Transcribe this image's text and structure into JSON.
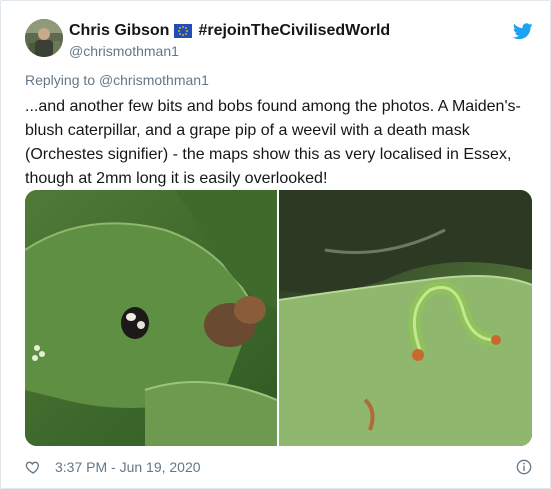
{
  "user": {
    "display_name": "Chris Gibson",
    "hashtag": "#rejoinTheCivilisedWorld",
    "handle": "@chrismothman1"
  },
  "reply": {
    "prefix": "Replying to",
    "mention": "@chrismothman1"
  },
  "tweet": {
    "text": "...and another few bits and bobs found among the photos. A Maiden's-blush caterpillar, and a grape pip of a weevil with a death mask (Orchestes signifier) - the maps show this as very localised in Essex, though at 2mm long it is easily overlooked!"
  },
  "footer": {
    "timestamp": "3:37 PM - Jun 19, 2020"
  },
  "icons": {
    "avatar": "avatar-photo",
    "flag": "eu-flag-icon",
    "brand": "twitter-bird-icon",
    "like": "heart-icon",
    "info": "info-icon"
  },
  "colors": {
    "brand_blue": "#1da1f2",
    "secondary_text": "#657786",
    "primary_text": "#14171a"
  }
}
